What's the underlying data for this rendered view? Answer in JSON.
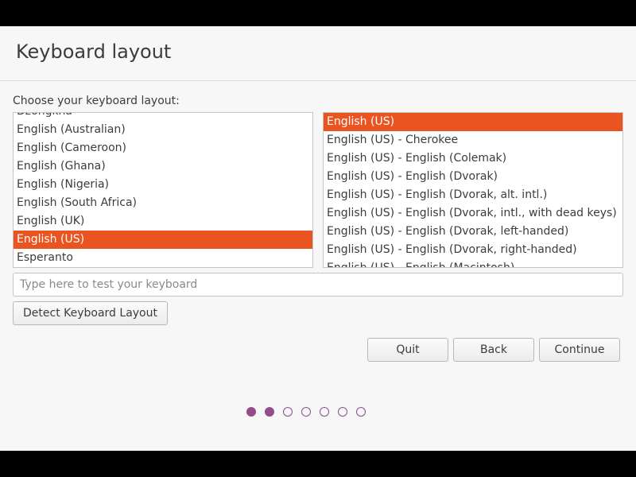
{
  "page": {
    "title": "Keyboard layout",
    "prompt": "Choose your keyboard layout:"
  },
  "layouts": {
    "items": [
      {
        "label": "Dzongkha",
        "selected": false
      },
      {
        "label": "English (Australian)",
        "selected": false
      },
      {
        "label": "English (Cameroon)",
        "selected": false
      },
      {
        "label": "English (Ghana)",
        "selected": false
      },
      {
        "label": "English (Nigeria)",
        "selected": false
      },
      {
        "label": "English (South Africa)",
        "selected": false
      },
      {
        "label": "English (UK)",
        "selected": false
      },
      {
        "label": "English (US)",
        "selected": true
      },
      {
        "label": "Esperanto",
        "selected": false
      }
    ]
  },
  "variants": {
    "items": [
      {
        "label": "English (US)",
        "selected": true
      },
      {
        "label": "English (US) - Cherokee",
        "selected": false
      },
      {
        "label": "English (US) - English (Colemak)",
        "selected": false
      },
      {
        "label": "English (US) - English (Dvorak)",
        "selected": false
      },
      {
        "label": "English (US) - English (Dvorak, alt. intl.)",
        "selected": false
      },
      {
        "label": "English (US) - English (Dvorak, intl., with dead keys)",
        "selected": false
      },
      {
        "label": "English (US) - English (Dvorak, left-handed)",
        "selected": false
      },
      {
        "label": "English (US) - English (Dvorak, right-handed)",
        "selected": false
      },
      {
        "label": "English (US) - English (Macintosh)",
        "selected": false
      }
    ]
  },
  "test_input": {
    "placeholder": "Type here to test your keyboard",
    "value": ""
  },
  "buttons": {
    "detect": "Detect Keyboard Layout",
    "quit": "Quit",
    "back": "Back",
    "continue": "Continue"
  },
  "progress": {
    "total_steps": 7,
    "completed_steps": 2
  },
  "colors": {
    "accent": "#e95420",
    "progress": "#924d8b",
    "background": "#f7f7f7"
  }
}
